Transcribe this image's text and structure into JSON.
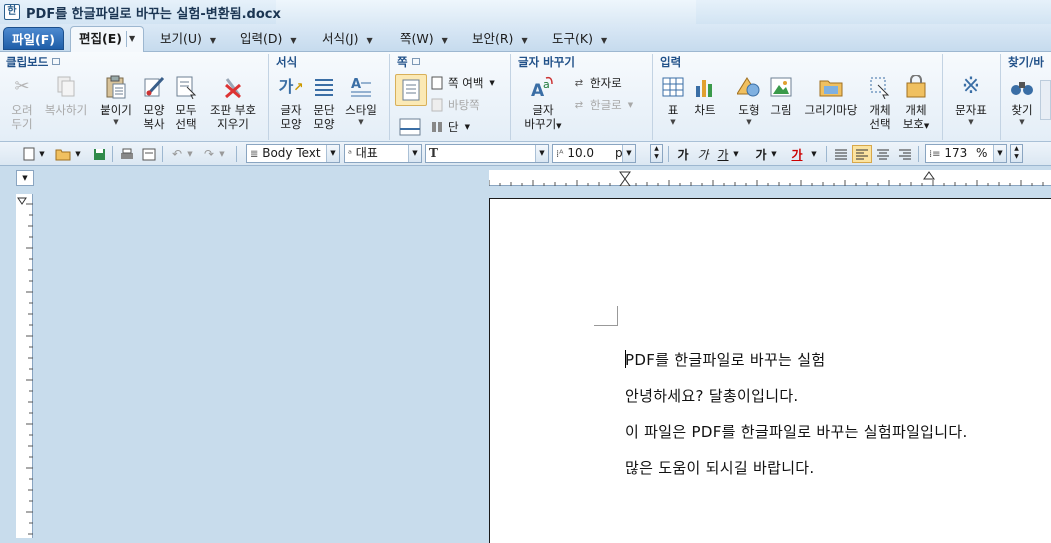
{
  "window": {
    "title": "PDF를 한글파일로 바꾸는 실험-변환됨.docx"
  },
  "menu": {
    "file": "파일(F)",
    "edit": "편집(E)",
    "items": [
      "보기(U)",
      "입력(D)",
      "서식(J)",
      "쪽(W)",
      "보안(R)",
      "도구(K)"
    ]
  },
  "ribbon": {
    "clipboard": {
      "label": "클립보드",
      "cut": [
        "오려",
        "두기"
      ],
      "copy": "복사하기",
      "paste": "붙이기",
      "format_copy": [
        "모양",
        "복사"
      ],
      "select_all": [
        "모두",
        "선택"
      ],
      "clear_format": [
        "조판 부호",
        "지우기"
      ]
    },
    "format": {
      "label": "서식",
      "char_shape": [
        "글자",
        "모양"
      ],
      "para_shape": [
        "문단",
        "모양"
      ],
      "style": "스타일"
    },
    "page": {
      "label": "쪽",
      "margin": "쪽 여백",
      "background": "바탕쪽",
      "column": "단"
    },
    "convert": {
      "label": "글자 바꾸기",
      "replace": [
        "글자",
        "바꾸기"
      ],
      "to_hanja": "한자로",
      "to_hangul": "한글로"
    },
    "insert": {
      "label": "입력",
      "table": "표",
      "chart": "차트",
      "shape": "도형",
      "picture": "그림",
      "drawing": "그리기마당",
      "object_select": [
        "개체",
        "선택"
      ],
      "object_protect": [
        "개체",
        "보호"
      ],
      "symbol": "문자표"
    },
    "find": {
      "label": "찾기/바",
      "find": "찾기"
    }
  },
  "toolbar": {
    "para_style": "Body Text",
    "lang": "대표",
    "font": "",
    "size": "10.0",
    "size_unit": "pt",
    "bold": "가",
    "italic": "가",
    "underline": "가",
    "strike": "가",
    "color": "가",
    "zoom": "173",
    "zoom_unit": "%"
  },
  "document": {
    "lines": [
      "PDF를 한글파일로 바꾸는 실험",
      "안녕하세요? 달총이입니다.",
      "이 파일은 PDF를 한글파일로 바꾸는 실험파일입니다.",
      "많은 도움이 되시길 바랍니다."
    ]
  },
  "colors": {
    "accent": "#215189",
    "file_tab": "#1f5ea8",
    "background": "#c8dcec"
  }
}
